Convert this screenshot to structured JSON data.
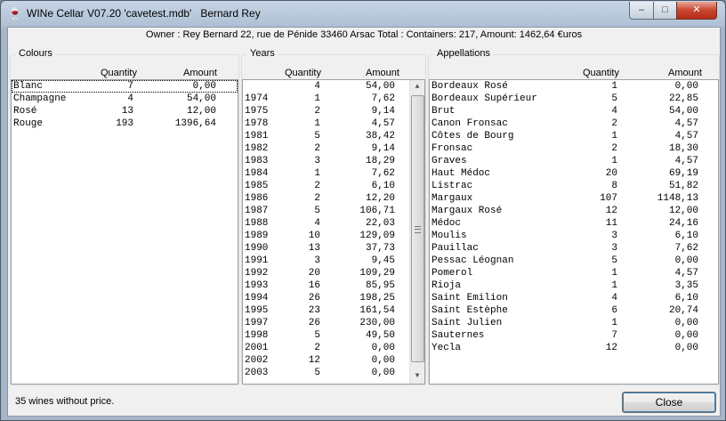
{
  "window": {
    "title": "WINe Cellar V07.20 'cavetest.mdb'   Bernard Rey",
    "min_glyph": "–",
    "max_glyph": "□",
    "close_glyph": "✕"
  },
  "owner_line": "Owner : Rey Bernard 22, rue de Pénide 33460 Arsac Total : Containers: 217, Amount: 1462,64 €uros",
  "colours": {
    "label": "Colours",
    "headers": {
      "quantity": "Quantity",
      "amount": "Amount"
    },
    "rows": [
      {
        "name": "Blanc",
        "qty": "7",
        "amt": "0,00"
      },
      {
        "name": "Champagne",
        "qty": "4",
        "amt": "54,00"
      },
      {
        "name": "Rosé",
        "qty": "13",
        "amt": "12,00"
      },
      {
        "name": "Rouge",
        "qty": "193",
        "amt": "1396,64"
      }
    ]
  },
  "years": {
    "label": "Years",
    "headers": {
      "quantity": "Quantity",
      "amount": "Amount"
    },
    "rows": [
      {
        "name": "",
        "qty": "4",
        "amt": "54,00"
      },
      {
        "name": "1974",
        "qty": "1",
        "amt": "7,62"
      },
      {
        "name": "1975",
        "qty": "2",
        "amt": "9,14"
      },
      {
        "name": "1978",
        "qty": "1",
        "amt": "4,57"
      },
      {
        "name": "1981",
        "qty": "5",
        "amt": "38,42"
      },
      {
        "name": "1982",
        "qty": "2",
        "amt": "9,14"
      },
      {
        "name": "1983",
        "qty": "3",
        "amt": "18,29"
      },
      {
        "name": "1984",
        "qty": "1",
        "amt": "7,62"
      },
      {
        "name": "1985",
        "qty": "2",
        "amt": "6,10"
      },
      {
        "name": "1986",
        "qty": "2",
        "amt": "12,20"
      },
      {
        "name": "1987",
        "qty": "5",
        "amt": "106,71"
      },
      {
        "name": "1988",
        "qty": "4",
        "amt": "22,03"
      },
      {
        "name": "1989",
        "qty": "10",
        "amt": "129,09"
      },
      {
        "name": "1990",
        "qty": "13",
        "amt": "37,73"
      },
      {
        "name": "1991",
        "qty": "3",
        "amt": "9,45"
      },
      {
        "name": "1992",
        "qty": "20",
        "amt": "109,29"
      },
      {
        "name": "1993",
        "qty": "16",
        "amt": "85,95"
      },
      {
        "name": "1994",
        "qty": "26",
        "amt": "198,25"
      },
      {
        "name": "1995",
        "qty": "23",
        "amt": "161,54"
      },
      {
        "name": "1997",
        "qty": "26",
        "amt": "230,00"
      },
      {
        "name": "1998",
        "qty": "5",
        "amt": "49,50"
      },
      {
        "name": "2001",
        "qty": "2",
        "amt": "0,00"
      },
      {
        "name": "2002",
        "qty": "12",
        "amt": "0,00"
      },
      {
        "name": "2003",
        "qty": "5",
        "amt": "0,00"
      }
    ]
  },
  "appellations": {
    "label": "Appellations",
    "headers": {
      "quantity": "Quantity",
      "amount": "Amount"
    },
    "rows": [
      {
        "name": "Bordeaux Rosé",
        "qty": "1",
        "amt": "0,00"
      },
      {
        "name": "Bordeaux Supérieur",
        "qty": "5",
        "amt": "22,85"
      },
      {
        "name": "Brut",
        "qty": "4",
        "amt": "54,00"
      },
      {
        "name": "Canon Fronsac",
        "qty": "2",
        "amt": "4,57"
      },
      {
        "name": "Côtes de Bourg",
        "qty": "1",
        "amt": "4,57"
      },
      {
        "name": "Fronsac",
        "qty": "2",
        "amt": "18,30"
      },
      {
        "name": "Graves",
        "qty": "1",
        "amt": "4,57"
      },
      {
        "name": "Haut Médoc",
        "qty": "20",
        "amt": "69,19"
      },
      {
        "name": "Listrac",
        "qty": "8",
        "amt": "51,82"
      },
      {
        "name": "Margaux",
        "qty": "107",
        "amt": "1148,13"
      },
      {
        "name": "Margaux Rosé",
        "qty": "12",
        "amt": "12,00"
      },
      {
        "name": "Médoc",
        "qty": "11",
        "amt": "24,16"
      },
      {
        "name": "Moulis",
        "qty": "3",
        "amt": "6,10"
      },
      {
        "name": "Pauillac",
        "qty": "3",
        "amt": "7,62"
      },
      {
        "name": "Pessac Léognan",
        "qty": "5",
        "amt": "0,00"
      },
      {
        "name": "Pomerol",
        "qty": "1",
        "amt": "4,57"
      },
      {
        "name": "Rioja",
        "qty": "1",
        "amt": "3,35"
      },
      {
        "name": "Saint Emilion",
        "qty": "4",
        "amt": "6,10"
      },
      {
        "name": "Saint Estèphe",
        "qty": "6",
        "amt": "20,74"
      },
      {
        "name": "Saint Julien",
        "qty": "1",
        "amt": "0,00"
      },
      {
        "name": "Sauternes",
        "qty": "7",
        "amt": "0,00"
      },
      {
        "name": "Yecla",
        "qty": "12",
        "amt": "0,00"
      }
    ]
  },
  "status_text": "35 wines without price.",
  "close_button": {
    "label": "Close"
  }
}
